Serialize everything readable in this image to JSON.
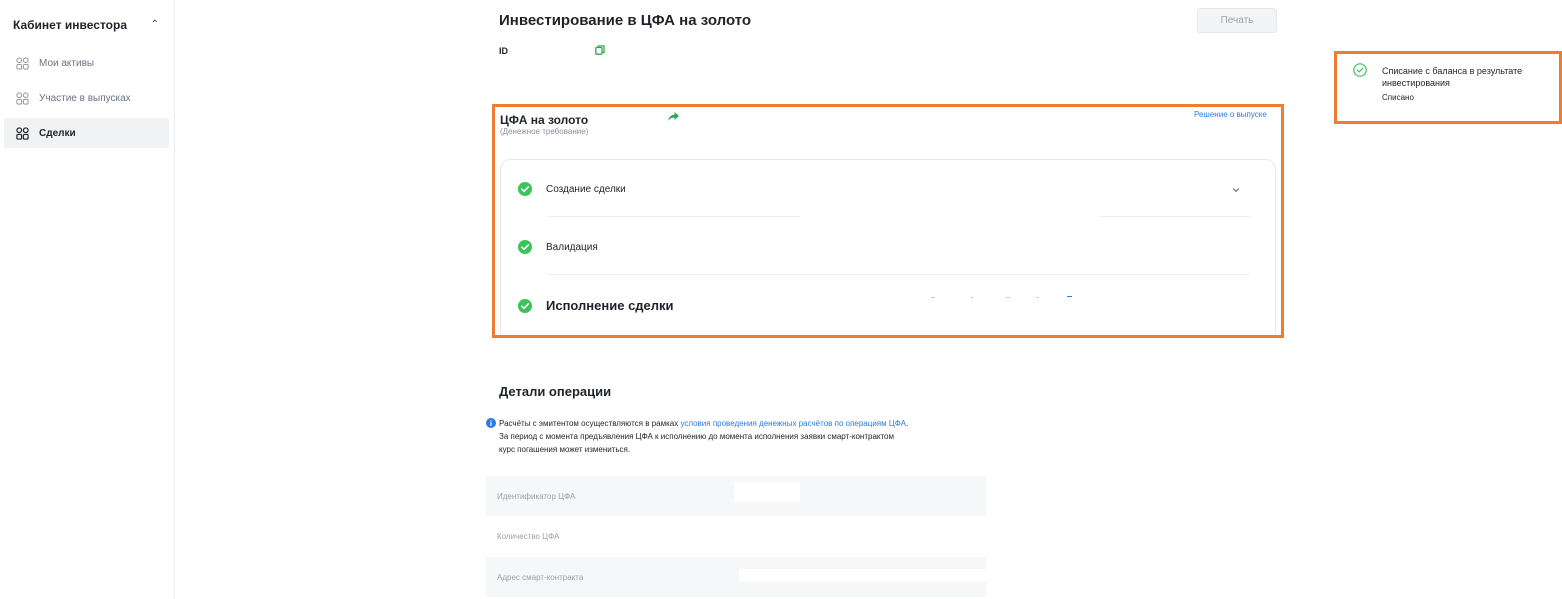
{
  "sidebar": {
    "title": "Кабинет инвестора",
    "items": [
      {
        "label": "Мои активы",
        "active": false
      },
      {
        "label": "Участие в выпусках",
        "active": false
      },
      {
        "label": "Сделки",
        "active": true
      }
    ]
  },
  "header": {
    "title": "Инвестирование в ЦФА на золото",
    "print_label": "Печать",
    "id_label": "ID"
  },
  "asset": {
    "title": "ЦФА на золото",
    "subtitle": "(Денежное требование)",
    "decision_link": "Решение о выпуске"
  },
  "steps": [
    {
      "label": "Создание сделки",
      "status": "done"
    },
    {
      "label": "Валидация",
      "status": "done"
    },
    {
      "label": "Исполнение сделки",
      "status": "done"
    }
  ],
  "notification": {
    "title": "Списание с баланса в результате инвестирования",
    "status": "Списано"
  },
  "details": {
    "title": "Детали операции",
    "info_prefix": "Расчёты с эмитентом осуществляются в рамках ",
    "info_link": "условия проведения денежных расчётов по операциям ЦФА",
    "info_suffix": ".",
    "info_line2": "За период с момента предъявления ЦФА к исполнению до момента исполнения заявки смарт-контрактом",
    "info_line3": "курс погашения может измениться.",
    "rows": [
      {
        "label": "Идентификатор ЦФА"
      },
      {
        "label": "Количество ЦФА"
      },
      {
        "label": "Адрес смарт-контракта"
      }
    ]
  },
  "colors": {
    "accent_blue": "#2b7be4",
    "success_green": "#3cc35a",
    "highlight_orange": "#ed7d31"
  },
  "icons": [
    "chevron-up-icon",
    "grid-icon",
    "copy-icon",
    "share-icon",
    "check-circle-icon",
    "chevron-down-icon",
    "info-icon",
    "check-outline-icon"
  ]
}
